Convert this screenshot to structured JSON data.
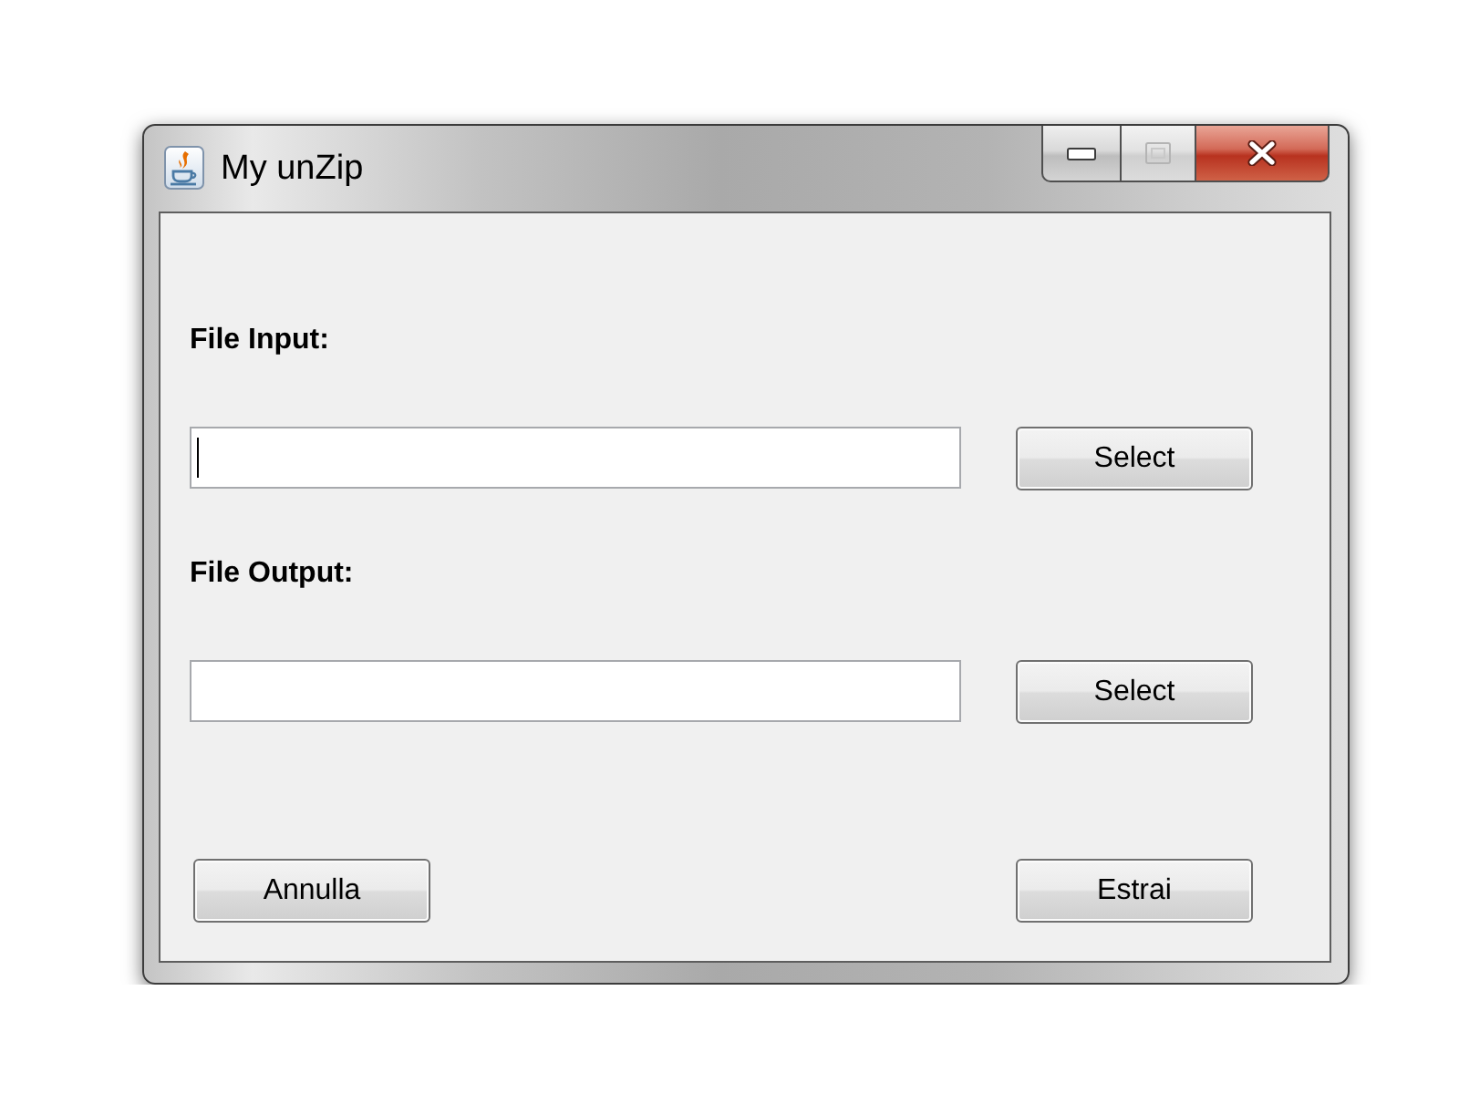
{
  "window": {
    "title": "My unZip"
  },
  "window_controls": [
    {
      "kind": "minimize",
      "disabled": false
    },
    {
      "kind": "maximize",
      "disabled": true
    },
    {
      "kind": "close",
      "disabled": false
    }
  ],
  "fields": [
    {
      "label": "File Input:",
      "focused": true,
      "button": "Select"
    },
    {
      "label": "File Output:",
      "focused": false,
      "button": "Select"
    }
  ],
  "buttons": [
    "Annulla",
    "Estrai"
  ]
}
